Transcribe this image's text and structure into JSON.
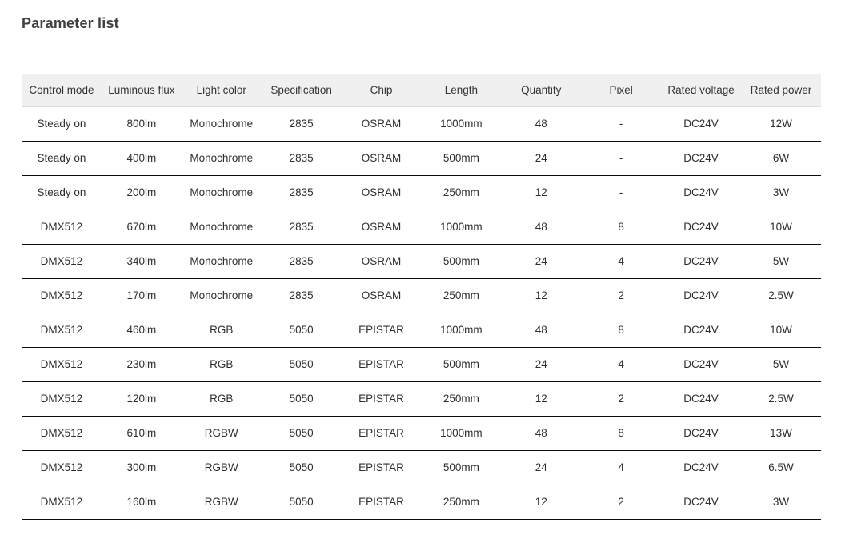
{
  "page": {
    "title": "Parameter list"
  },
  "colors": {
    "header_background": "#f0f0f0",
    "row_divider": "#0d0d0d",
    "title_text": "#3e4144",
    "body_text": "#333333"
  },
  "table": {
    "columns": [
      "Control mode",
      "Luminous flux",
      "Light color",
      "Specification",
      "Chip",
      "Length",
      "Quantity",
      "Pixel",
      "Rated voltage",
      "Rated power"
    ],
    "rows": [
      [
        "Steady on",
        "800lm",
        "Monochrome",
        "2835",
        "OSRAM",
        "1000mm",
        "48",
        "-",
        "DC24V",
        "12W"
      ],
      [
        "Steady on",
        "400lm",
        "Monochrome",
        "2835",
        "OSRAM",
        "500mm",
        "24",
        "-",
        "DC24V",
        "6W"
      ],
      [
        "Steady on",
        "200lm",
        "Monochrome",
        "2835",
        "OSRAM",
        "250mm",
        "12",
        "-",
        "DC24V",
        "3W"
      ],
      [
        "DMX512",
        "670lm",
        "Monochrome",
        "2835",
        "OSRAM",
        "1000mm",
        "48",
        "8",
        "DC24V",
        "10W"
      ],
      [
        "DMX512",
        "340lm",
        "Monochrome",
        "2835",
        "OSRAM",
        "500mm",
        "24",
        "4",
        "DC24V",
        "5W"
      ],
      [
        "DMX512",
        "170lm",
        "Monochrome",
        "2835",
        "OSRAM",
        "250mm",
        "12",
        "2",
        "DC24V",
        "2.5W"
      ],
      [
        "DMX512",
        "460lm",
        "RGB",
        "5050",
        "EPISTAR",
        "1000mm",
        "48",
        "8",
        "DC24V",
        "10W"
      ],
      [
        "DMX512",
        "230lm",
        "RGB",
        "5050",
        "EPISTAR",
        "500mm",
        "24",
        "4",
        "DC24V",
        "5W"
      ],
      [
        "DMX512",
        "120lm",
        "RGB",
        "5050",
        "EPISTAR",
        "250mm",
        "12",
        "2",
        "DC24V",
        "2.5W"
      ],
      [
        "DMX512",
        "610lm",
        "RGBW",
        "5050",
        "EPISTAR",
        "1000mm",
        "48",
        "8",
        "DC24V",
        "13W"
      ],
      [
        "DMX512",
        "300lm",
        "RGBW",
        "5050",
        "EPISTAR",
        "500mm",
        "24",
        "4",
        "DC24V",
        "6.5W"
      ],
      [
        "DMX512",
        "160lm",
        "RGBW",
        "5050",
        "EPISTAR",
        "250mm",
        "12",
        "2",
        "DC24V",
        "3W"
      ]
    ]
  }
}
